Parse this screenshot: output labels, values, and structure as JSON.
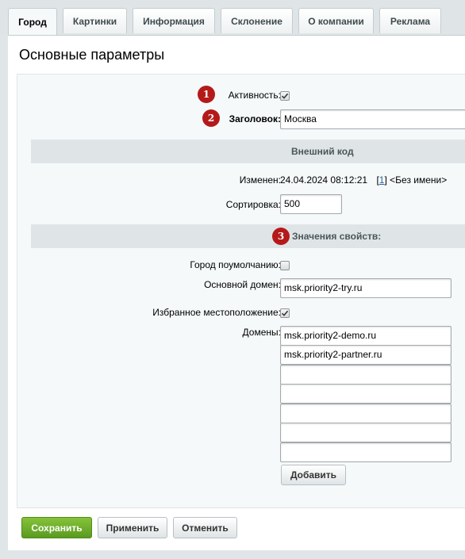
{
  "tabs": [
    {
      "label": "Город",
      "active": true
    },
    {
      "label": "Картинки",
      "active": false
    },
    {
      "label": "Информация",
      "active": false
    },
    {
      "label": "Склонение",
      "active": false
    },
    {
      "label": "О компании",
      "active": false
    },
    {
      "label": "Реклама",
      "active": false
    }
  ],
  "panel": {
    "title": "Основные параметры"
  },
  "fields": {
    "active": {
      "label": "Активность:",
      "checked": true,
      "badge": "1"
    },
    "title": {
      "label": "Заголовок:",
      "value": "Москва",
      "badge": "2"
    },
    "external_code_section": "Внешний код",
    "modified": {
      "label": "Изменен:",
      "datetime": "24.04.2024 08:12:21",
      "user_link": "1",
      "user_open": "[",
      "user_close": "]",
      "user_name": "<Без имени>"
    },
    "sort": {
      "label": "Сортировка:",
      "value": "500"
    },
    "properties_section": {
      "label": "Значения свойств:",
      "badge": "3"
    },
    "default_city": {
      "label": "Город поумолчанию:",
      "checked": false
    },
    "main_domain": {
      "label": "Основной домен:",
      "value": "msk.priority2-try.ru"
    },
    "favorite_location": {
      "label": "Избранное местоположение:",
      "checked": true
    },
    "domains": {
      "label": "Домены:",
      "values": [
        "msk.priority2-demo.ru",
        "msk.priority2-partner.ru",
        "",
        "",
        "",
        "",
        ""
      ],
      "add_label": "Добавить"
    }
  },
  "buttons": {
    "save": "Сохранить",
    "apply": "Применить",
    "cancel": "Отменить"
  },
  "colors": {
    "badge": "#b41a1a",
    "save_button": "#6aab2a",
    "background": "#e0e6e8"
  }
}
